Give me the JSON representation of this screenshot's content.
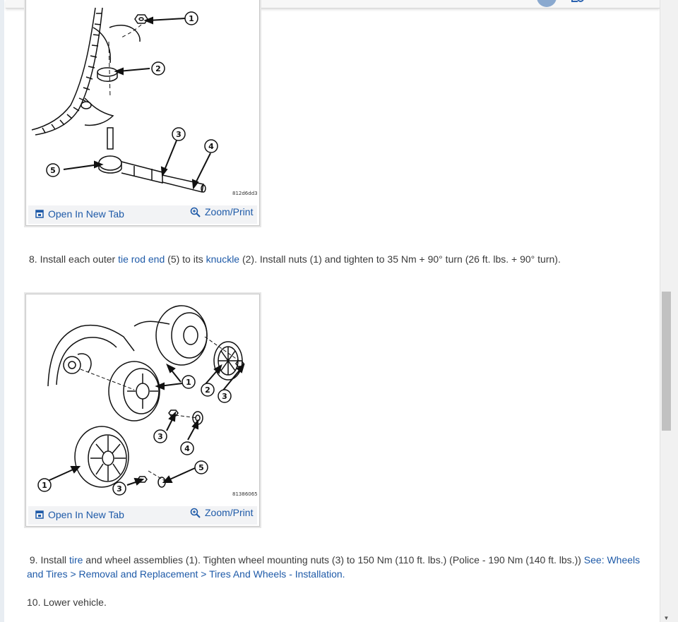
{
  "figure1": {
    "code": "812d6dd3",
    "callouts": [
      "1",
      "2",
      "3",
      "4",
      "5"
    ],
    "open_tab": "Open In New Tab",
    "zoom": "Zoom/Print"
  },
  "step8": {
    "num": "8.",
    "t1": "Install each outer ",
    "link1": "tie rod end",
    "t2": " (5) to its ",
    "link2": "knuckle",
    "t3": " (2). Install nuts (1) and tighten to 35 Nm + 90° turn (26 ft. lbs. + 90° turn)."
  },
  "figure2": {
    "code": "81386065",
    "callouts": [
      "1",
      "2",
      "3",
      "3",
      "4",
      "1",
      "3",
      "5"
    ],
    "open_tab": "Open In New Tab",
    "zoom": "Zoom/Print"
  },
  "step9": {
    "num": "9.",
    "t1": "Install ",
    "link1": "tire",
    "t2": " and wheel assemblies (1). Tighten wheel mounting nuts (3) to 150 Nm (110 ft. lbs.) (Police - 190 Nm (140 ft. lbs.)) ",
    "link2": "See: Wheels and Tires > Removal and Replacement > Tires And Wheels - Installation."
  },
  "step10": {
    "text": "10. Lower vehicle."
  }
}
